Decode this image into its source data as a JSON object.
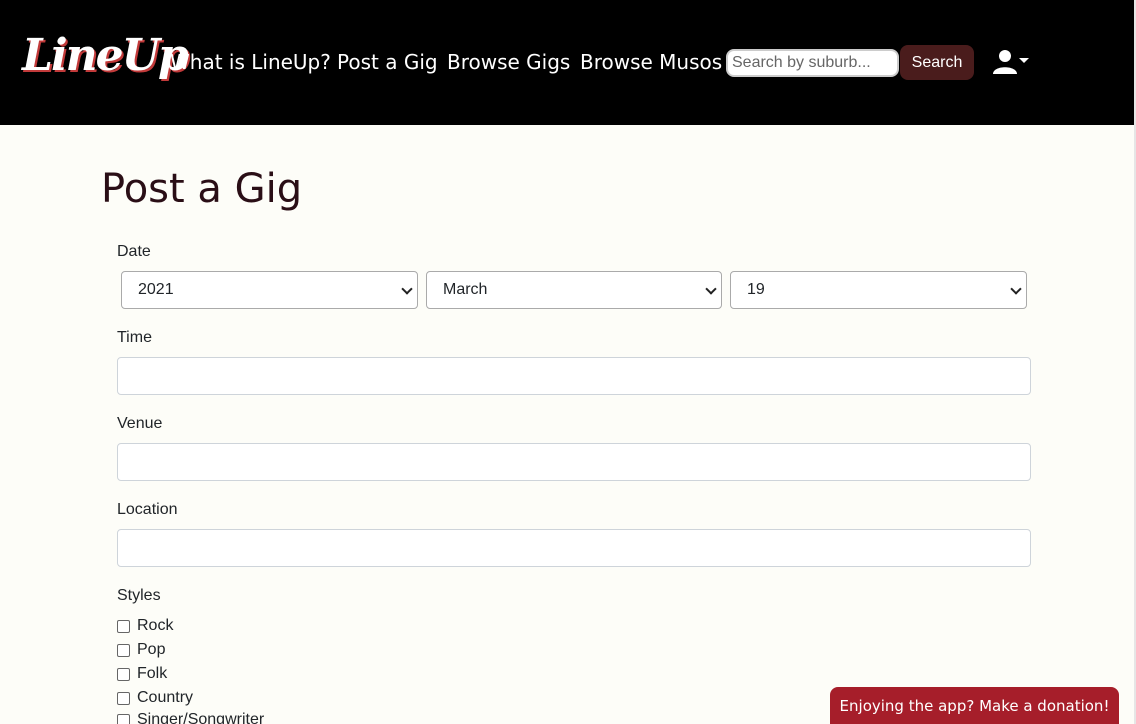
{
  "navbar": {
    "logo": "LineUp",
    "links": [
      "What is LineUp?",
      "Post a Gig",
      "Browse Gigs",
      "Browse Musos"
    ],
    "search_placeholder": "Search by suburb...",
    "search_button": "Search",
    "user_icon": "user-icon"
  },
  "page": {
    "title": "Post a Gig"
  },
  "form": {
    "date_label": "Date",
    "year": "2021",
    "month": "March",
    "day": "19",
    "time_label": "Time",
    "time_value": "",
    "venue_label": "Venue",
    "venue_value": "",
    "location_label": "Location",
    "location_value": "",
    "styles_label": "Styles",
    "styles": [
      "Rock",
      "Pop",
      "Folk",
      "Country",
      "Singer/Songwriter"
    ]
  },
  "donate": {
    "label": "Enjoying the app? Make a donation!"
  },
  "colors": {
    "nav_bg": "#000000",
    "search_button": "#4a1c1c",
    "donate_bg": "#a61e2a",
    "title": "#2a0e16",
    "page_bg": "#fdfdf8"
  }
}
